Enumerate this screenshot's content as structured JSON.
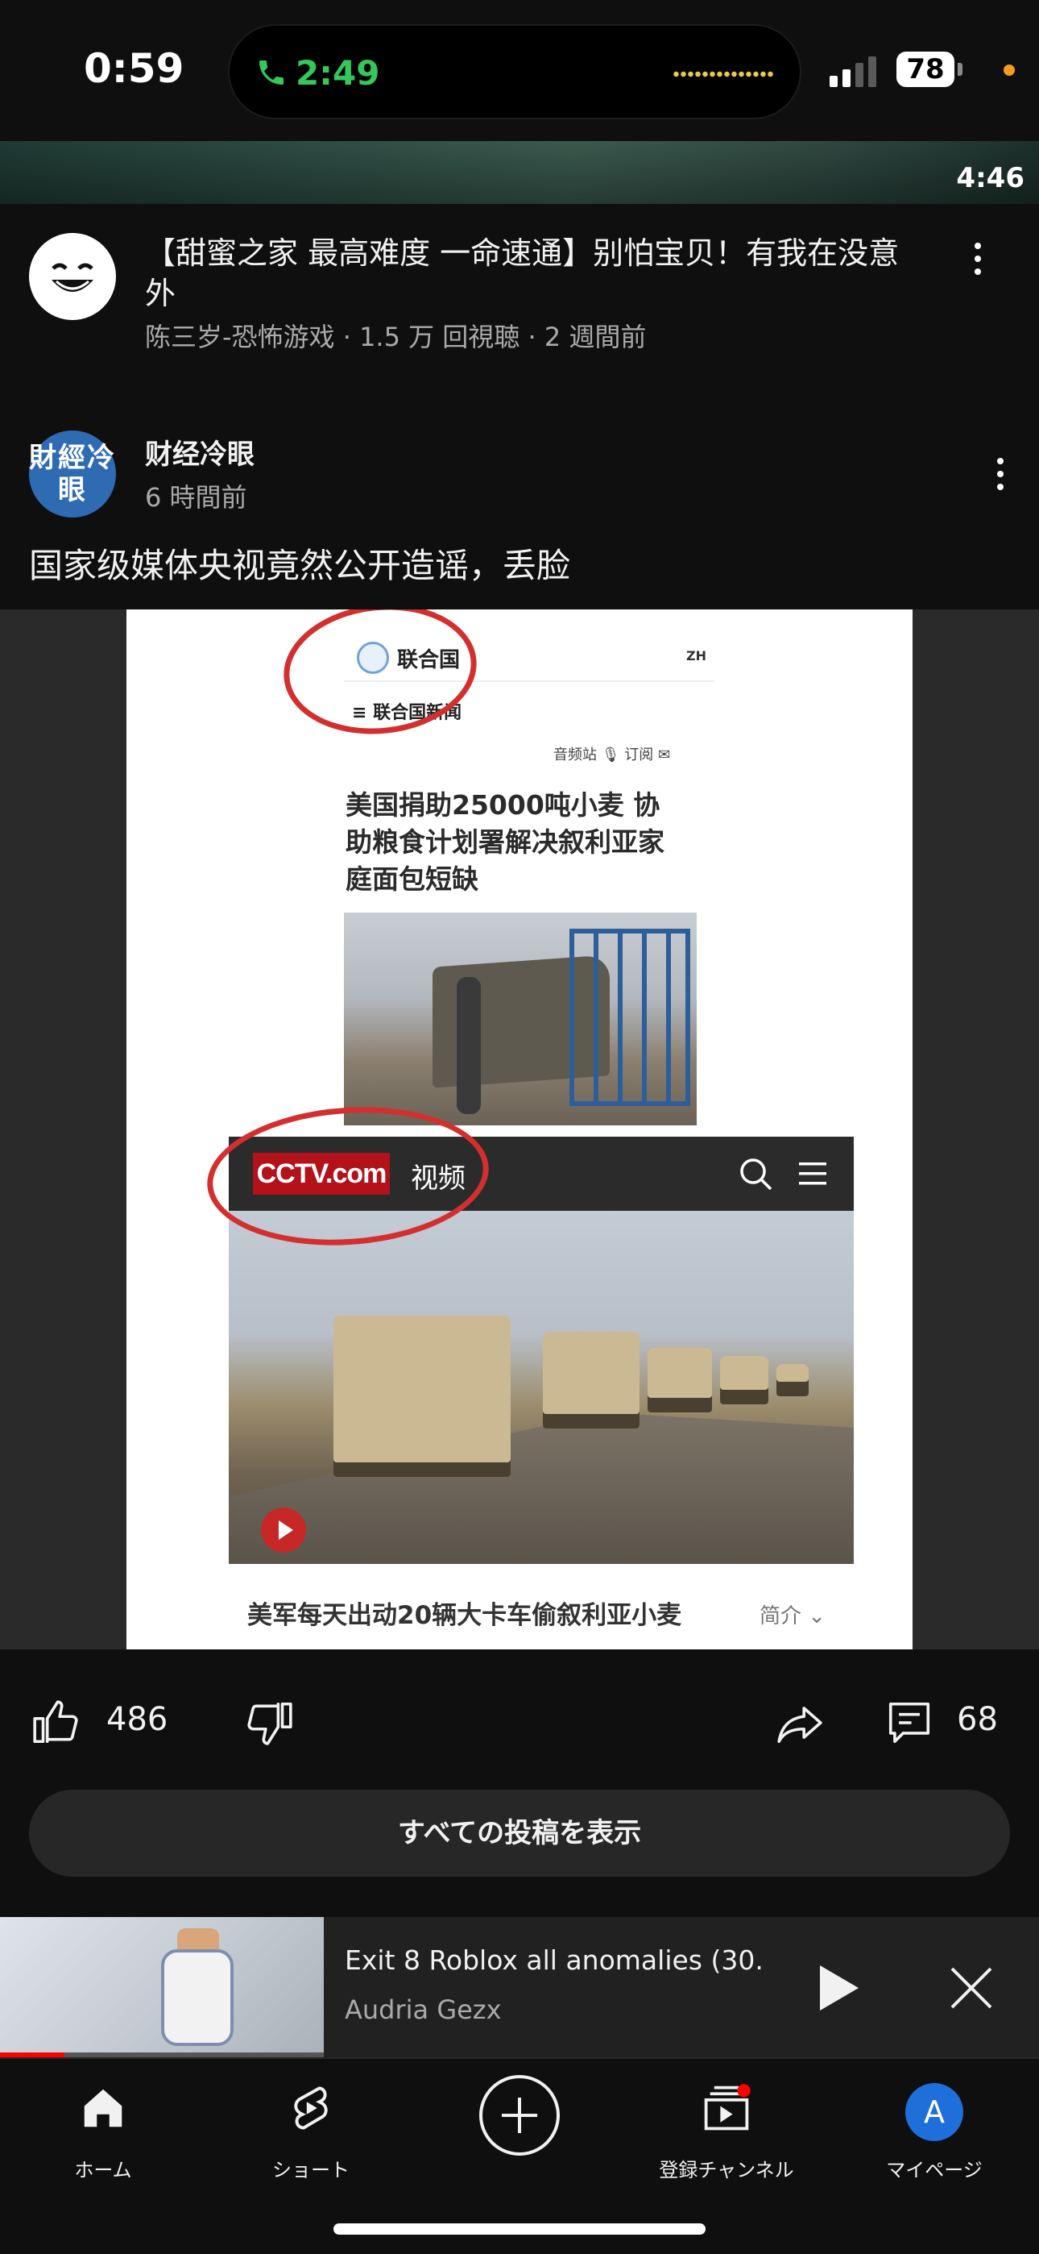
{
  "status_bar": {
    "time": "0:59",
    "call_timer": "2:49",
    "battery": "78"
  },
  "top_video": {
    "duration": "4:46"
  },
  "video": {
    "title": "【甜蜜之家 最高难度 一命速通】别怕宝贝！有我在没意外",
    "meta": "陈三岁-恐怖游戏 · 1.5 万 回視聴 · 2 週間前"
  },
  "post": {
    "channel": "财经冷眼",
    "avatar_text": "財經冷眼",
    "time": "6 時間前",
    "text": "国家级媒体央视竟然公开造谣，丢脸",
    "image": {
      "un_name": "联合国",
      "un_lang": "ZH",
      "un_news": "≡ 联合国新闻",
      "un_tools": "音频站 🎙 订阅 ✉",
      "un_headline": "美国捐助25000吨小麦 协助粮食计划署解决叙利亚家庭面包短缺",
      "cctv_logo": "CCTV.com",
      "cctv_tab": "视频",
      "cctv_caption": "美军每天出动20辆大卡车偷叙利亚小麦",
      "cctv_intro": "简介 ⌄"
    },
    "likes": "486",
    "comments": "68"
  },
  "show_all_label": "すべての投稿を表示",
  "mini_player": {
    "title": "Exit 8 Roblox all anomalies (30...",
    "channel": "Audria Gezx",
    "progress": 0.2
  },
  "nav": {
    "home": "ホーム",
    "shorts": "ショート",
    "subscriptions": "登録チャンネル",
    "mypage": "マイページ",
    "account_initial": "A"
  },
  "colors": {
    "background": "#0f0f0f",
    "accent_red": "#ff0000",
    "call_green": "#34c759",
    "avatar_blue": "#1e6fd9"
  }
}
